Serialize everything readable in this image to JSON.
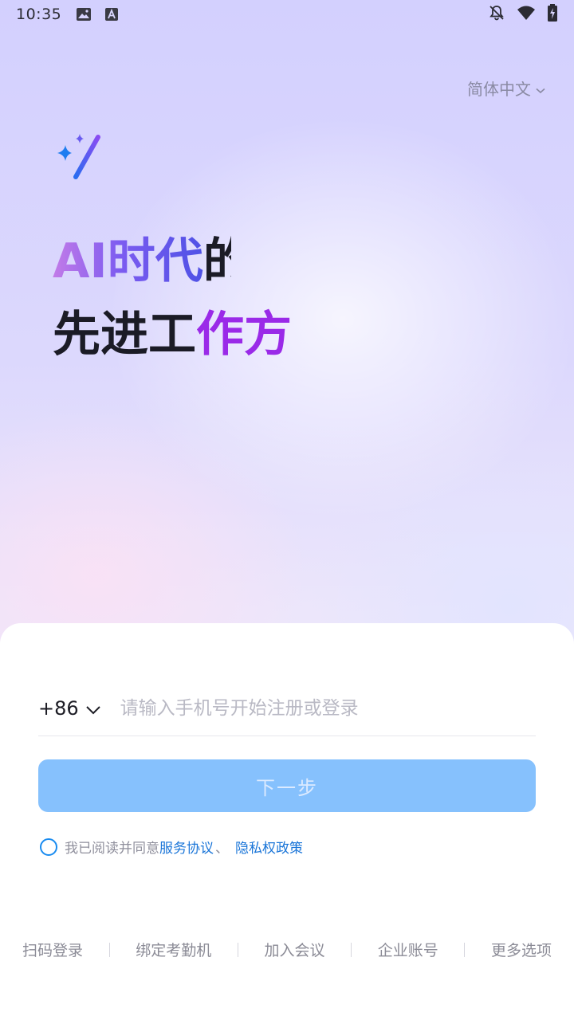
{
  "status_bar": {
    "time": "10:35",
    "left_icons": [
      "image-icon",
      "font-a-icon"
    ],
    "right_icons": [
      "bell-off-icon",
      "wifi-icon",
      "battery-charging-icon"
    ]
  },
  "language": {
    "label": "简体中文",
    "icon": "chevron-down-icon"
  },
  "hero": {
    "line1_grad": "AI时代",
    "line1_rest": "的",
    "line2_dark": "先进工",
    "line2_violet": "作方"
  },
  "login": {
    "country_code": "+86",
    "phone_placeholder": "请输入手机号开始注册或登录",
    "next_label": "下一步",
    "agree_prefix": "我已阅读并同意",
    "terms_link": "服务协议",
    "separator": "、",
    "privacy_link": "隐私权政策"
  },
  "bottom_options": [
    "扫码登录",
    "绑定考勤机",
    "加入会议",
    "企业账号",
    "更多选项"
  ],
  "colors": {
    "primary_disabled": "#86c1fd",
    "link": "#1a75d8",
    "accent_violet": "#9a2ae8"
  }
}
